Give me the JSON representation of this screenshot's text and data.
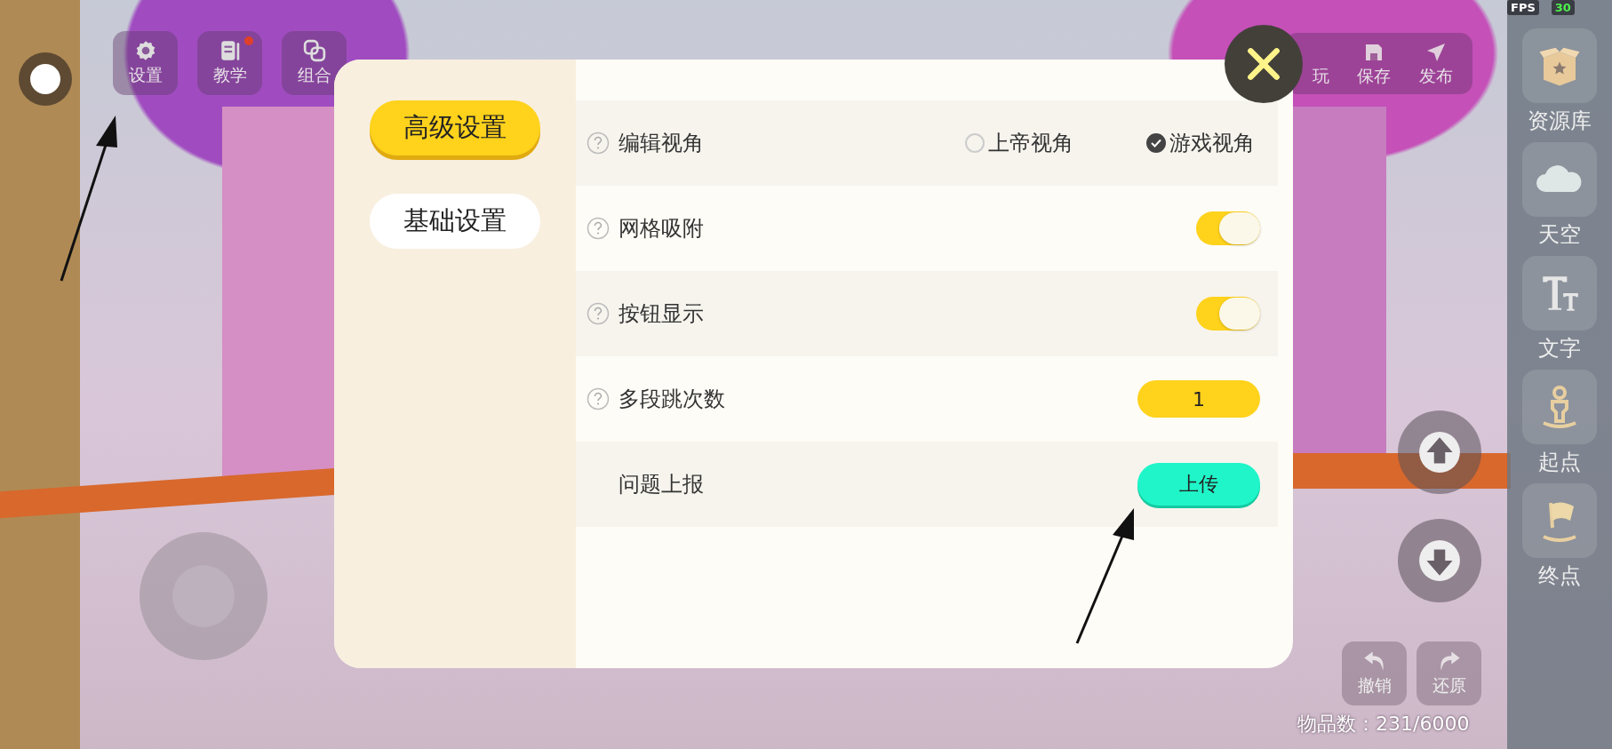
{
  "fps": {
    "label": "FPS",
    "value": "30"
  },
  "top_left_tools": [
    {
      "label": "设置",
      "badge": false
    },
    {
      "label": "教学",
      "badge": true
    },
    {
      "label": "组合",
      "badge": false
    }
  ],
  "top_right_tools": [
    {
      "label": "玩"
    },
    {
      "label": "保存"
    },
    {
      "label": "发布"
    }
  ],
  "side_panel": [
    {
      "label": "资源库"
    },
    {
      "label": "天空"
    },
    {
      "label": "文字"
    },
    {
      "label": "起点"
    },
    {
      "label": "终点"
    }
  ],
  "settings_dialog": {
    "tabs": [
      {
        "label": "高级设置",
        "selected": true
      },
      {
        "label": "基础设置",
        "selected": false
      }
    ],
    "rows": [
      {
        "kind": "radio",
        "label": "编辑视角",
        "help": true,
        "options": [
          {
            "label": "上帝视角",
            "selected": false
          },
          {
            "label": "游戏视角",
            "selected": true
          }
        ]
      },
      {
        "kind": "toggle",
        "label": "网格吸附",
        "help": true,
        "on": true
      },
      {
        "kind": "toggle",
        "label": "按钮显示",
        "help": true,
        "on": true
      },
      {
        "kind": "value",
        "label": "多段跳次数",
        "help": true,
        "value": "1"
      },
      {
        "kind": "button",
        "label": "问题上报",
        "help": false,
        "button": "上传"
      }
    ]
  },
  "history_buttons": [
    {
      "label": "撤销"
    },
    {
      "label": "还原"
    }
  ],
  "item_count": "物品数：231/6000"
}
